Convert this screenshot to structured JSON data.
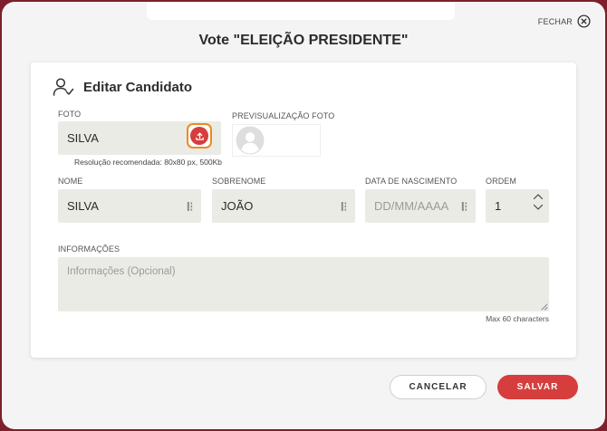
{
  "dialog": {
    "title": "Vote \"ELEIÇÃO PRESIDENTE\"",
    "close_label": "FECHAR"
  },
  "card": {
    "title": "Editar Candidato"
  },
  "photo": {
    "label": "FOTO",
    "value": "SILVA",
    "hint": "Resolução recomendada: 80x80 px, 500Kb",
    "preview_label": "PREVISUALIZAÇÃO FOTO"
  },
  "fields": {
    "nome": {
      "label": "NOME",
      "value": "SILVA"
    },
    "sobrenome": {
      "label": "SOBRENOME",
      "value": "JOÃO"
    },
    "nascimento": {
      "label": "DATA DE NASCIMENTO",
      "placeholder": "DD/MM/AAAA"
    },
    "ordem": {
      "label": "ORDEM",
      "value": "1"
    }
  },
  "info": {
    "label": "INFORMAÇÕES",
    "placeholder": "Informações (Opcional)",
    "counter": "Max 60 characters"
  },
  "actions": {
    "cancel": "CANCELAR",
    "save": "SALVAR"
  },
  "colors": {
    "frame": "#7d1f2c",
    "accent": "#d63d3d",
    "highlight": "#ee8a1f",
    "field_bg": "#ebebe6"
  },
  "icons": {
    "close": "close-circle-icon",
    "user": "user-check-icon",
    "upload": "upload-icon",
    "avatar": "avatar-placeholder-icon",
    "drag": "drag-handle-icon",
    "stepper_up": "chevron-up-icon",
    "stepper_down": "chevron-down-icon",
    "resize": "resize-handle-icon"
  }
}
